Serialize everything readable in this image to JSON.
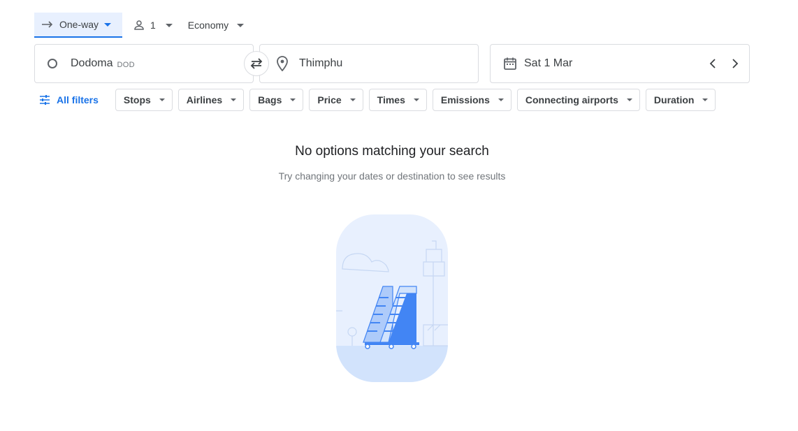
{
  "trip": {
    "type_label": "One-way",
    "passengers": "1",
    "cabin": "Economy"
  },
  "search": {
    "origin": {
      "city": "Dodoma",
      "code": "DOD"
    },
    "destination": {
      "city": "Thimphu"
    },
    "date": "Sat 1 Mar"
  },
  "filters": {
    "all_label": "All filters",
    "chips": [
      "Stops",
      "Airlines",
      "Bags",
      "Price",
      "Times",
      "Emissions",
      "Connecting airports",
      "Duration"
    ]
  },
  "empty_state": {
    "title": "No options matching your search",
    "subtitle": "Try changing your dates or destination to see results"
  },
  "colors": {
    "accent": "#1a73e8",
    "accent_bg": "#e8f0fe",
    "border": "#dadce0",
    "illustration_bg": "#e8f0fe"
  }
}
